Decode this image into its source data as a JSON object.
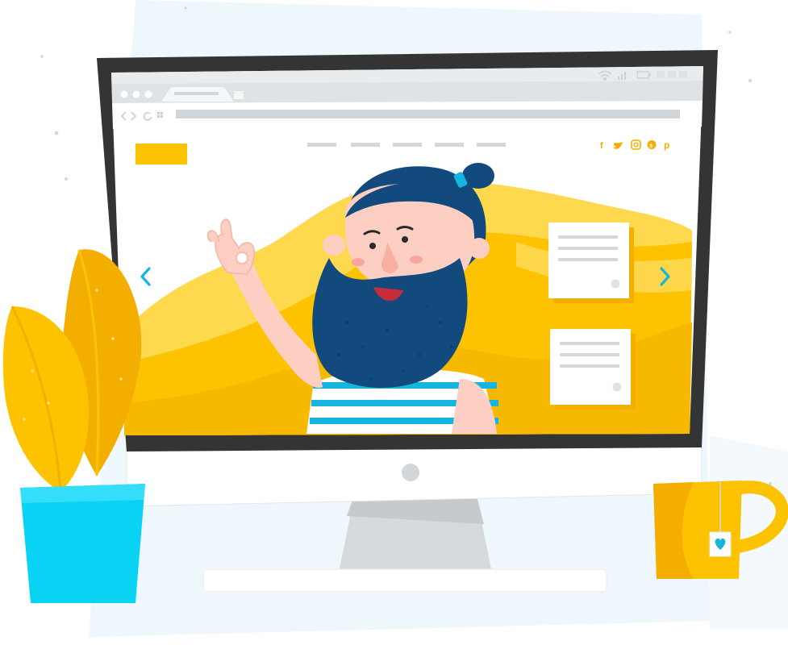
{
  "colors": {
    "bezel": "#343434",
    "screen_bg": "#ffffff",
    "browser_chrome": "#dfe3e6",
    "address_bar": "#cfd5d9",
    "accent_yellow": "#fdc300",
    "yellow_light": "#ffd94d",
    "yellow_dark": "#f4ae00",
    "nav_arrow": "#16b5e0",
    "beard": "#124a7e",
    "skin": "#fccfc2",
    "pot": "#08d3f4",
    "monitor_body": "#ffffff",
    "stand": "#d6dadd",
    "backdrop": "#eef7fb"
  },
  "browser": {
    "window_dots": 3,
    "nav_bars": 5,
    "social_icons": [
      "facebook-icon",
      "twitter-icon",
      "instagram-icon",
      "skype-icon",
      "pinterest-icon"
    ],
    "status_icons": [
      "wifi-icon",
      "signal-icon",
      "battery-icon"
    ]
  },
  "website": {
    "cards": 2,
    "slider_arrows": [
      "prev-arrow-icon",
      "next-arrow-icon"
    ]
  }
}
